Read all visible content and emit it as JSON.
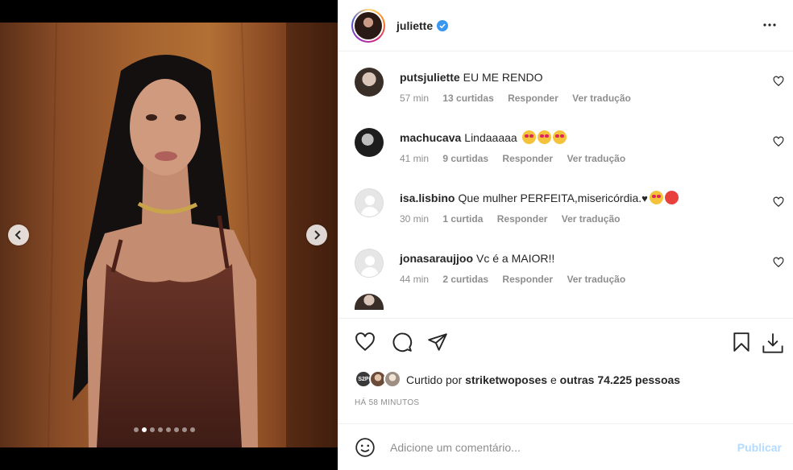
{
  "post": {
    "author": "juliette",
    "verified": true
  },
  "media": {
    "image_description_icon": "portrait-photo",
    "dots_total": 8,
    "dot_active_index": 1
  },
  "comments": [
    {
      "user": "putsjuliette",
      "text": "EU ME RENDO",
      "emojis": [],
      "time": "57 min",
      "likes": "13 curtidas",
      "reply": "Responder",
      "translate": "Ver tradução"
    },
    {
      "user": "machucava",
      "text": "Lindaaaaa",
      "emojis": [
        "heart-eyes-smiling",
        "heart-eyes",
        "heart-eyes"
      ],
      "time": "41 min",
      "likes": "9 curtidas",
      "reply": "Responder",
      "translate": "Ver tradução"
    },
    {
      "user": "isa.lisbino",
      "text": "Que mulher PERFEITA,misericórdia.",
      "emojis": [
        "black-heart",
        "heart-eyes",
        "angry-face"
      ],
      "time": "30 min",
      "likes": "1 curtida",
      "reply": "Responder",
      "translate": "Ver tradução"
    },
    {
      "user": "jonasaraujjoo",
      "text": "Vc é a MAIOR!!",
      "emojis": [],
      "time": "44 min",
      "likes": "2 curtidas",
      "reply": "Responder",
      "translate": "Ver tradução"
    }
  ],
  "likes": {
    "prefix": "Curtido por",
    "first_user": "striketwoposes",
    "connector": "e",
    "others": "outras 74.225 pessoas",
    "mini_avatar_label": "S2P"
  },
  "timestamp": "HÁ 58 MINUTOS",
  "add_comment": {
    "placeholder": "Adicione um comentário...",
    "publish": "Publicar"
  },
  "colors": {
    "verified": "#3897f0",
    "publish_disabled": "#b3dbff",
    "meta_gray": "#8e8e8e"
  }
}
